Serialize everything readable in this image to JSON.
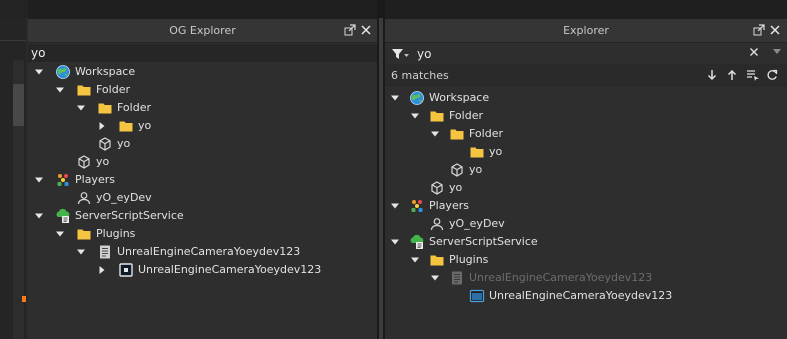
{
  "og_explorer": {
    "title": "OG Explorer",
    "filter_value": "yo",
    "tree": [
      {
        "label": "Workspace",
        "icon": "workspace-icon",
        "depth": 0,
        "expander": "expanded"
      },
      {
        "label": "Folder",
        "icon": "folder-icon",
        "depth": 1,
        "expander": "expanded"
      },
      {
        "label": "Folder",
        "icon": "folder-icon",
        "depth": 2,
        "expander": "expanded"
      },
      {
        "label": "yo",
        "icon": "folder-icon",
        "depth": 3,
        "expander": "collapsed"
      },
      {
        "label": "yo",
        "icon": "part-icon",
        "depth": 2,
        "expander": "none"
      },
      {
        "label": "yo",
        "icon": "part-icon",
        "depth": 1,
        "expander": "none"
      },
      {
        "label": "Players",
        "icon": "players-icon",
        "depth": 0,
        "expander": "expanded"
      },
      {
        "label": "yO_eyDev",
        "icon": "player-icon",
        "depth": 1,
        "expander": "none"
      },
      {
        "label": "ServerScriptService",
        "icon": "server-script-service-icon",
        "depth": 0,
        "expander": "expanded"
      },
      {
        "label": "Plugins",
        "icon": "folder-icon",
        "depth": 1,
        "expander": "expanded"
      },
      {
        "label": "UnrealEngineCameraYoeydev123",
        "icon": "script-icon",
        "depth": 2,
        "expander": "expanded"
      },
      {
        "label": "UnrealEngineCameraYoeydev123",
        "icon": "screen-gui-icon",
        "depth": 3,
        "expander": "collapsed"
      }
    ]
  },
  "explorer": {
    "title": "Explorer",
    "search_value": "yo",
    "match_count": "6 matches",
    "tree": [
      {
        "label": "Workspace",
        "icon": "workspace-icon",
        "depth": 0,
        "expander": "expanded"
      },
      {
        "label": "Folder",
        "icon": "folder-icon",
        "depth": 1,
        "expander": "expanded"
      },
      {
        "label": "Folder",
        "icon": "folder-icon",
        "depth": 2,
        "expander": "expanded"
      },
      {
        "label": "yo",
        "icon": "folder-icon",
        "depth": 3,
        "expander": "none"
      },
      {
        "label": "yo",
        "icon": "part-icon",
        "depth": 2,
        "expander": "none"
      },
      {
        "label": "yo",
        "icon": "part-icon",
        "depth": 1,
        "expander": "none"
      },
      {
        "label": "Players",
        "icon": "players-icon",
        "depth": 0,
        "expander": "expanded"
      },
      {
        "label": "yO_eyDev",
        "icon": "player-icon",
        "depth": 1,
        "expander": "none"
      },
      {
        "label": "ServerScriptService",
        "icon": "server-script-service-icon",
        "depth": 0,
        "expander": "expanded"
      },
      {
        "label": "Plugins",
        "icon": "folder-icon",
        "depth": 1,
        "expander": "expanded"
      },
      {
        "label": "UnrealEngineCameraYoeydev123",
        "icon": "script-icon",
        "depth": 2,
        "expander": "expanded",
        "dimmed": true
      },
      {
        "label": "UnrealEngineCameraYoeydev123",
        "icon": "screen-gui-icon",
        "depth": 3,
        "expander": "none"
      }
    ]
  },
  "colors": {
    "folder": "#f5c542",
    "orange_marker": "#ff7a1a"
  }
}
